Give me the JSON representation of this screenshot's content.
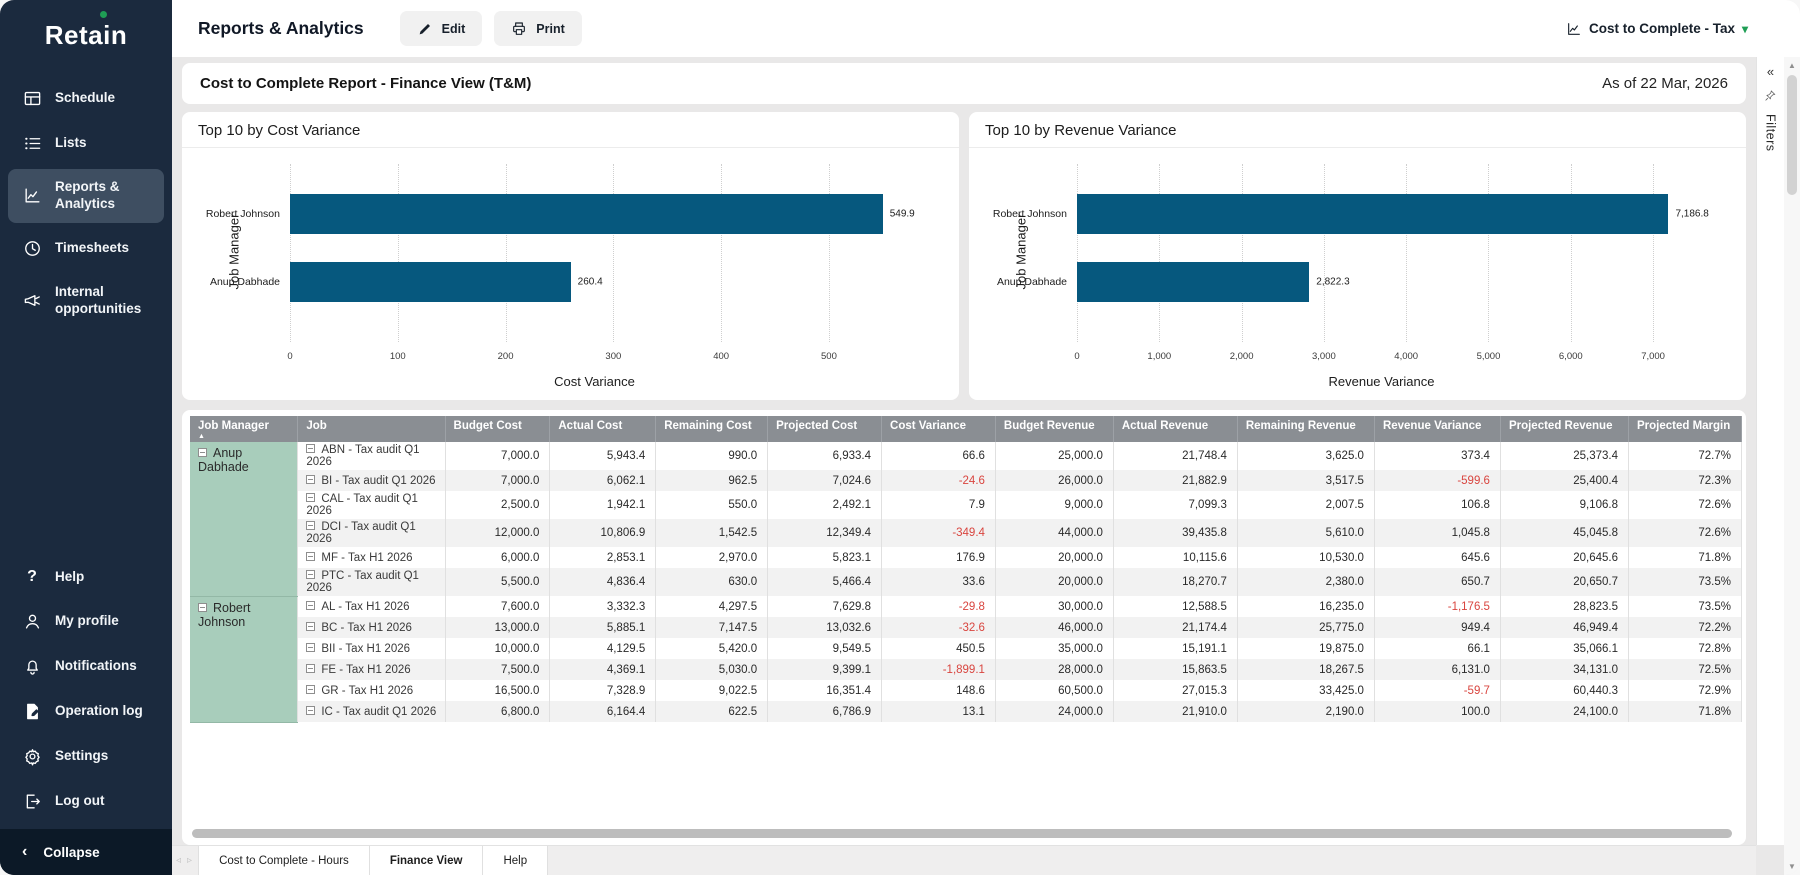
{
  "app": {
    "logo": "Retain"
  },
  "sidebar": {
    "items": [
      {
        "label": "Schedule",
        "icon": "schedule-icon",
        "active": false
      },
      {
        "label": "Lists",
        "icon": "lists-icon",
        "active": false
      },
      {
        "label": "Reports & Analytics",
        "icon": "reports-analytics-icon",
        "active": true
      },
      {
        "label": "Timesheets",
        "icon": "timesheets-icon",
        "active": false
      },
      {
        "label": "Internal opportunities",
        "icon": "megaphone-icon",
        "active": false
      }
    ],
    "footer_items": [
      {
        "label": "Help",
        "icon": "help-icon"
      },
      {
        "label": "My profile",
        "icon": "profile-icon"
      },
      {
        "label": "Notifications",
        "icon": "bell-icon"
      },
      {
        "label": "Operation log",
        "icon": "operation-log-icon"
      },
      {
        "label": "Settings",
        "icon": "gear-icon"
      },
      {
        "label": "Log out",
        "icon": "logout-icon"
      }
    ],
    "collapse_label": "Collapse"
  },
  "topbar": {
    "title": "Reports & Analytics",
    "edit_label": "Edit",
    "print_label": "Print",
    "report_selector": "Cost to Complete - Tax"
  },
  "report_header": {
    "title": "Cost to Complete Report - Finance View (T&M)",
    "as_of": "As of 22 Mar, 2026"
  },
  "chart_data": [
    {
      "type": "bar",
      "orientation": "horizontal",
      "title": "Top 10 by Cost Variance",
      "categories": [
        "Robert Johnson",
        "Anup Dabhade"
      ],
      "values": [
        549.9,
        260.4
      ],
      "value_labels": [
        "549.9",
        "260.4"
      ],
      "xlabel": "Cost Variance",
      "ylabel": "Job Manager",
      "xlim": [
        0,
        565
      ],
      "xticks": [
        {
          "v": 0,
          "label": "0"
        },
        {
          "v": 100,
          "label": "100"
        },
        {
          "v": 200,
          "label": "200"
        },
        {
          "v": 300,
          "label": "300"
        },
        {
          "v": 400,
          "label": "400"
        },
        {
          "v": 500,
          "label": "500"
        }
      ],
      "grid": "dotted-vertical",
      "bar_color": "#06587e"
    },
    {
      "type": "bar",
      "orientation": "horizontal",
      "title": "Top 10 by Revenue Variance",
      "categories": [
        "Robert Johnson",
        "Anup Dabhade"
      ],
      "values": [
        7186.8,
        2822.3
      ],
      "value_labels": [
        "7,186.8",
        "2,822.3"
      ],
      "xlabel": "Revenue Variance",
      "ylabel": "Job Manager",
      "xlim": [
        0,
        7400
      ],
      "xticks": [
        {
          "v": 0,
          "label": "0"
        },
        {
          "v": 1000,
          "label": "1,000"
        },
        {
          "v": 2000,
          "label": "2,000"
        },
        {
          "v": 3000,
          "label": "3,000"
        },
        {
          "v": 4000,
          "label": "4,000"
        },
        {
          "v": 5000,
          "label": "5,000"
        },
        {
          "v": 6000,
          "label": "6,000"
        },
        {
          "v": 7000,
          "label": "7,000"
        }
      ],
      "grid": "dotted-vertical",
      "bar_color": "#06587e"
    }
  ],
  "table": {
    "columns": [
      "Job Manager",
      "Job",
      "Budget Cost",
      "Actual Cost",
      "Remaining Cost",
      "Projected Cost",
      "Cost Variance",
      "Budget Revenue",
      "Actual Revenue",
      "Remaining Revenue",
      "Revenue Variance",
      "Projected Revenue",
      "Projected Margin"
    ],
    "sort": {
      "column": "Job Manager",
      "direction": "asc"
    },
    "groups": [
      {
        "manager": "Anup Dabhade",
        "rows": [
          {
            "job": "ABN - Tax audit Q1 2026",
            "values": [
              "7,000.0",
              "5,943.4",
              "990.0",
              "6,933.4",
              "66.6",
              "25,000.0",
              "21,748.4",
              "3,625.0",
              "373.4",
              "25,373.4",
              "72.7%"
            ]
          },
          {
            "job": "BI - Tax audit Q1 2026",
            "values": [
              "7,000.0",
              "6,062.1",
              "962.5",
              "7,024.6",
              "-24.6",
              "26,000.0",
              "21,882.9",
              "3,517.5",
              "-599.6",
              "25,400.4",
              "72.3%"
            ]
          },
          {
            "job": "CAL - Tax audit Q1 2026",
            "values": [
              "2,500.0",
              "1,942.1",
              "550.0",
              "2,492.1",
              "7.9",
              "9,000.0",
              "7,099.3",
              "2,007.5",
              "106.8",
              "9,106.8",
              "72.6%"
            ]
          },
          {
            "job": "DCI - Tax audit Q1 2026",
            "values": [
              "12,000.0",
              "10,806.9",
              "1,542.5",
              "12,349.4",
              "-349.4",
              "44,000.0",
              "39,435.8",
              "5,610.0",
              "1,045.8",
              "45,045.8",
              "72.6%"
            ]
          },
          {
            "job": "MF - Tax H1 2026",
            "values": [
              "6,000.0",
              "2,853.1",
              "2,970.0",
              "5,823.1",
              "176.9",
              "20,000.0",
              "10,115.6",
              "10,530.0",
              "645.6",
              "20,645.6",
              "71.8%"
            ]
          },
          {
            "job": "PTC - Tax audit Q1 2026",
            "values": [
              "5,500.0",
              "4,836.4",
              "630.0",
              "5,466.4",
              "33.6",
              "20,000.0",
              "18,270.7",
              "2,380.0",
              "650.7",
              "20,650.7",
              "73.5%"
            ]
          }
        ]
      },
      {
        "manager": "Robert Johnson",
        "rows": [
          {
            "job": "AL - Tax H1 2026",
            "values": [
              "7,600.0",
              "3,332.3",
              "4,297.5",
              "7,629.8",
              "-29.8",
              "30,000.0",
              "12,588.5",
              "16,235.0",
              "-1,176.5",
              "28,823.5",
              "73.5%"
            ]
          },
          {
            "job": "BC - Tax H1 2026",
            "values": [
              "13,000.0",
              "5,885.1",
              "7,147.5",
              "13,032.6",
              "-32.6",
              "46,000.0",
              "21,174.4",
              "25,775.0",
              "949.4",
              "46,949.4",
              "72.2%"
            ]
          },
          {
            "job": "BII - Tax H1 2026",
            "values": [
              "10,000.0",
              "4,129.5",
              "5,420.0",
              "9,549.5",
              "450.5",
              "35,000.0",
              "15,191.1",
              "19,875.0",
              "66.1",
              "35,066.1",
              "72.8%"
            ]
          },
          {
            "job": "FE - Tax H1 2026",
            "values": [
              "7,500.0",
              "4,369.1",
              "5,030.0",
              "9,399.1",
              "-1,899.1",
              "28,000.0",
              "15,863.5",
              "18,267.5",
              "6,131.0",
              "34,131.0",
              "72.5%"
            ]
          },
          {
            "job": "GR - Tax H1 2026",
            "values": [
              "16,500.0",
              "7,328.9",
              "9,022.5",
              "16,351.4",
              "148.6",
              "60,500.0",
              "27,015.3",
              "33,425.0",
              "-59.7",
              "60,440.3",
              "72.9%"
            ]
          },
          {
            "job": "IC - Tax audit Q1 2026",
            "values": [
              "6,800.0",
              "6,164.4",
              "622.5",
              "6,786.9",
              "13.1",
              "24,000.0",
              "21,910.0",
              "2,190.0",
              "100.0",
              "24,100.0",
              "71.8%"
            ]
          }
        ]
      }
    ]
  },
  "filters_panel": {
    "label": "Filters"
  },
  "tabs": {
    "items": [
      {
        "label": "Cost to Complete - Hours",
        "active": false
      },
      {
        "label": "Finance View",
        "active": true
      },
      {
        "label": "Help",
        "active": false
      }
    ]
  },
  "colors": {
    "sidebar_bg": "#1b2a3e",
    "sidebar_active_bg": "#3e4e61",
    "bar_teal": "#06587e",
    "negative_red": "#d9453f",
    "manager_green": "#a8cdbb",
    "table_header_gray": "#8a8e93",
    "accent_green": "#1f9e55"
  }
}
